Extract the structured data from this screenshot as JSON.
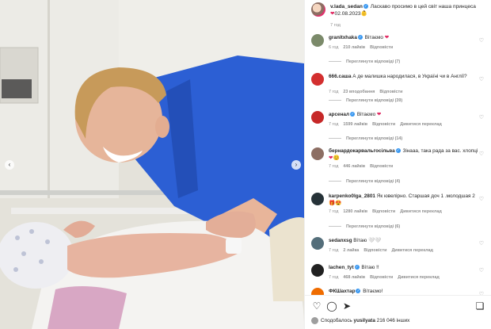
{
  "post": {
    "author": "v.lada_sedan",
    "caption": "Ласкаво просимо в цей світ наша принцеса",
    "caption_date": "02.08.2023",
    "time": "7 год"
  },
  "labels": {
    "reply": "Відповісти",
    "translate": "Дивитися переклад"
  },
  "comments": [
    {
      "user": "granitxhaka",
      "verified": true,
      "text": "Вітаємо",
      "emoji": "❤",
      "time": "6 год",
      "likes": "210 лайків",
      "translate": false,
      "replies": "Переглянути відповіді (7)",
      "avatar_color": "#7b8a6a"
    },
    {
      "user": "666.саша",
      "verified": false,
      "text": "А де малишка народилася, в Україні чи в Англії?",
      "emoji": "",
      "time": "7 год",
      "likes": "23 вподобання",
      "translate": false,
      "replies": "Переглянути відповіді (39)",
      "avatar_color": "#d32f2f"
    },
    {
      "user": "арсенал",
      "verified": true,
      "text": "Вітаємо",
      "emoji": "❤",
      "time": "7 год",
      "likes": "1599 лайків",
      "translate": true,
      "replies": "Переглянути відповіді (14)",
      "avatar_color": "#c62828"
    },
    {
      "user": "бернардокарвальгосільва",
      "verified": true,
      "text": "Зінааа, така рада за вас. хлопці",
      "emoji": "❤😊",
      "time": "7 год",
      "likes": "446 лайків",
      "translate": false,
      "replies": "Переглянути відповіді (4)",
      "avatar_color": "#8d6e63"
    },
    {
      "user": "karpenko0lga_2801",
      "verified": false,
      "text": "Як ювелірно. Старшая доч 1 .молодшая 2",
      "emoji": "🎁😍",
      "time": "7 год",
      "likes": "1280 лайків",
      "translate": true,
      "replies": "Переглянути відповіді (6)",
      "avatar_color": "#263238"
    },
    {
      "user": "sedanxsg",
      "verified": false,
      "text": "Вітаю",
      "emoji": "🤍🤍",
      "time": "7 год",
      "likes": "2 лайка",
      "translate": true,
      "replies": "",
      "avatar_color": "#546e7a"
    },
    {
      "user": "lachen_tyt",
      "verified": true,
      "text": "Вітаю !!",
      "emoji": "",
      "time": "7 год",
      "likes": "468 лайків",
      "translate": true,
      "replies": "",
      "avatar_color": "#212121"
    },
    {
      "user": "ФКШахтар",
      "verified": true,
      "text": "Вітаємо!",
      "emoji": "",
      "time": "",
      "likes": "",
      "translate": false,
      "replies": "",
      "avatar_color": "#ef6c00"
    }
  ],
  "actions": {
    "liked_by_prefix": "Сподобалось",
    "liked_by_user": "yusilyata",
    "liked_by_suffix": "216 046 інших"
  },
  "icons": [
    "heart-icon",
    "comment-icon",
    "share-icon",
    "bookmark-icon",
    "chevron-left-icon",
    "chevron-right-icon"
  ]
}
